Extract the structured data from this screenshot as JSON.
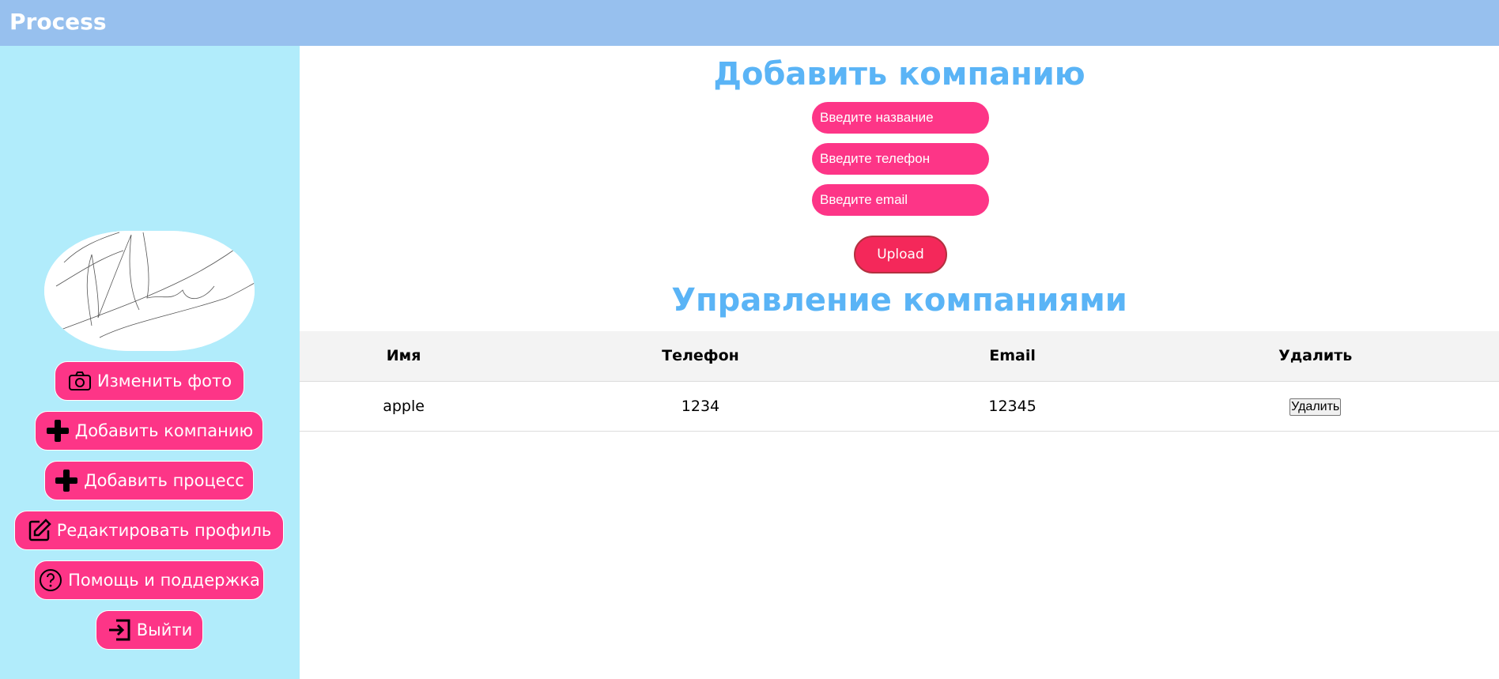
{
  "header": {
    "brand": "Process",
    "accent": "#97c0ee"
  },
  "sidebar": {
    "background": "#b1ecfb",
    "avatar_alt": "signature",
    "items": [
      {
        "label": "Изменить фото",
        "icon": "camera-icon"
      },
      {
        "label": "Добавить компанию",
        "icon": "plus-icon"
      },
      {
        "label": "Добавить процесс",
        "icon": "plus-icon"
      },
      {
        "label": "Редактировать профиль",
        "icon": "edit-icon"
      },
      {
        "label": "Помощь и поддержка",
        "icon": "help-icon"
      },
      {
        "label": "Выйти",
        "icon": "logout-icon"
      }
    ],
    "button_color": "#fd3587"
  },
  "add_company": {
    "title": "Добавить компанию",
    "name_placeholder": "Введите название",
    "phone_placeholder": "Введите телефон",
    "email_placeholder": "Введите email",
    "upload_label": "Upload"
  },
  "manage": {
    "title": "Управление компаниями",
    "columns": [
      "Имя",
      "Телефон",
      "Email",
      "Удалить"
    ],
    "rows": [
      {
        "name": "apple",
        "phone": "1234",
        "email": "12345",
        "action": "Удалить"
      }
    ]
  }
}
